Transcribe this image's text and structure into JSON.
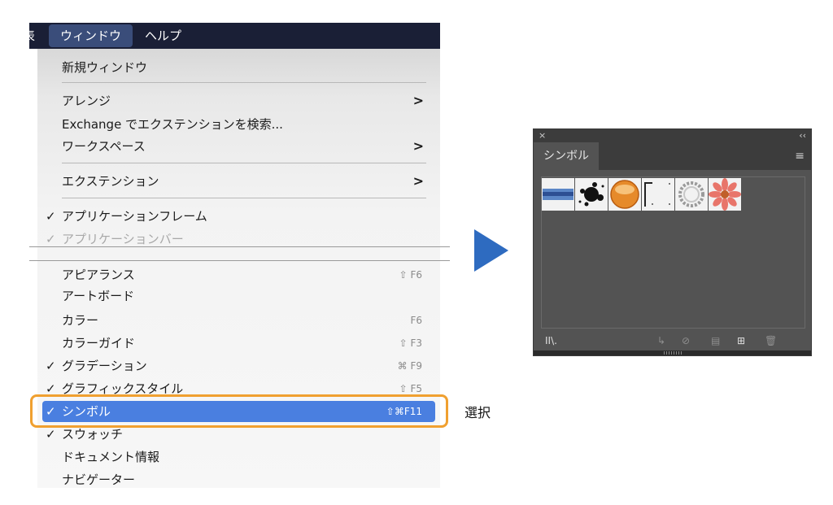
{
  "menubar": {
    "cut_label": "表",
    "window_label": "ウィンドウ",
    "help_label": "ヘルプ"
  },
  "menu": {
    "new_window": "新規ウィンドウ",
    "arrange": "アレンジ",
    "exchange": "Exchange でエクステンションを検索...",
    "workspace": "ワークスペース",
    "extensions": "エクステンション",
    "app_frame": "アプリケーションフレーム",
    "app_bar": "アプリケーションバー",
    "appearance": "アピアランス",
    "appearance_sc": "⇧ F6",
    "artboard": "アートボード",
    "color": "カラー",
    "color_sc": "F6",
    "color_guide": "カラーガイド",
    "color_guide_sc": "⇧ F3",
    "gradient": "グラデーション",
    "gradient_sc": "⌘ F9",
    "graphic_styles": "グラフィックスタイル",
    "graphic_styles_sc": "⇧ F5",
    "symbols": "シンボル",
    "symbols_sc": "⇧⌘F11",
    "swatches": "スウォッチ",
    "doc_info": "ドキュメント情報",
    "navigator": "ナビゲーター",
    "check": "✓",
    "submenu_arrow": ">"
  },
  "callout": {
    "text": "選択"
  },
  "panel": {
    "close": "×",
    "collapse": "‹‹",
    "tab": "シンボル",
    "menu_icon": "≡",
    "library_icon": "IⅠ\\.",
    "place_icon": "↳",
    "break_link_icon": "⊘",
    "options_icon": "▤",
    "new_icon": "⊞",
    "delete_icon": "🗑"
  },
  "colors": {
    "menubar_bg": "#1a1f36",
    "selection": "#4a7fe0",
    "highlight": "#f0a030",
    "arrow": "#2e6bc0",
    "panel_bg": "#535353"
  }
}
